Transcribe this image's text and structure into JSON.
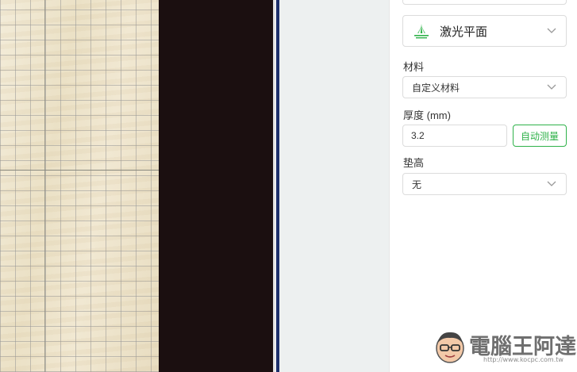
{
  "panel": {
    "mode": {
      "label": "激光平面",
      "icon": "laser-plane-icon"
    },
    "material": {
      "label": "材料",
      "value": "自定义材料"
    },
    "thickness": {
      "label": "厚度 (mm)",
      "value": "3.2",
      "measure_button": "自动测量"
    },
    "raise": {
      "label": "垫高",
      "value": "无"
    }
  },
  "watermark": {
    "text": "電腦王阿達",
    "url": "http://www.kocpc.com.tw"
  },
  "colors": {
    "accent_green": "#2fb24a",
    "gutter": "#edf0f0",
    "dark_band": "#1b0f10",
    "wood": "#efe6d0"
  }
}
